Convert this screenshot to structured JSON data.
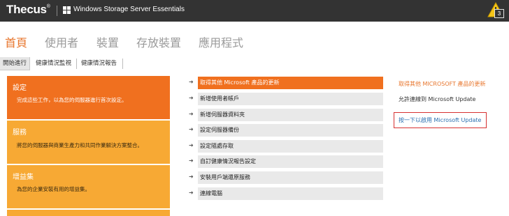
{
  "topbar": {
    "brand": "Thecus",
    "brand_mark": "®",
    "product": "Windows Storage Server Essentials",
    "alert_count": "3",
    "windows_icon": "windows-logo",
    "alert_icon": "warning-triangle-icon"
  },
  "main_nav": {
    "items": [
      "首頁",
      "使用者",
      "裝置",
      "存放裝置",
      "應用程式"
    ],
    "active": "首頁"
  },
  "sub_tabs": {
    "items": [
      "開始進行",
      "健康情況監視",
      "健康情況報告"
    ],
    "active": "開始進行"
  },
  "panels": [
    {
      "title": "設定",
      "description": "完成這些工作，以為您的伺服器進行首次設定。",
      "color": "#f0701f"
    },
    {
      "title": "服務",
      "description": "將您的伺服器與商業生產力和共同作業解決方案整合。",
      "color": "#f7a934"
    },
    {
      "title": "增益集",
      "description": "為您的企業安裝有用的增益集。",
      "color": "#f7a934"
    }
  ],
  "tasks": {
    "items": [
      "取得其他 Microsoft 產品的更新",
      "新增使用者帳戶",
      "新增伺服器資料夾",
      "設定伺服器備份",
      "設定隨處存取",
      "自訂健康情況報告設定",
      "安裝用戶端還原服務",
      "連線電腦"
    ],
    "active": "取得其他 Microsoft 產品的更新"
  },
  "detail": {
    "title": "取得其他 MICROSOFT 產品的更新",
    "description": "允許連線到 Microsoft Update",
    "action_link": "按一下以啟用 Microsoft Update"
  },
  "colors": {
    "topbar": "#333333",
    "accent": "#e8762d",
    "task_active": "#f0701f",
    "link": "#2a6fb0",
    "highlight_box": "#d63030"
  }
}
